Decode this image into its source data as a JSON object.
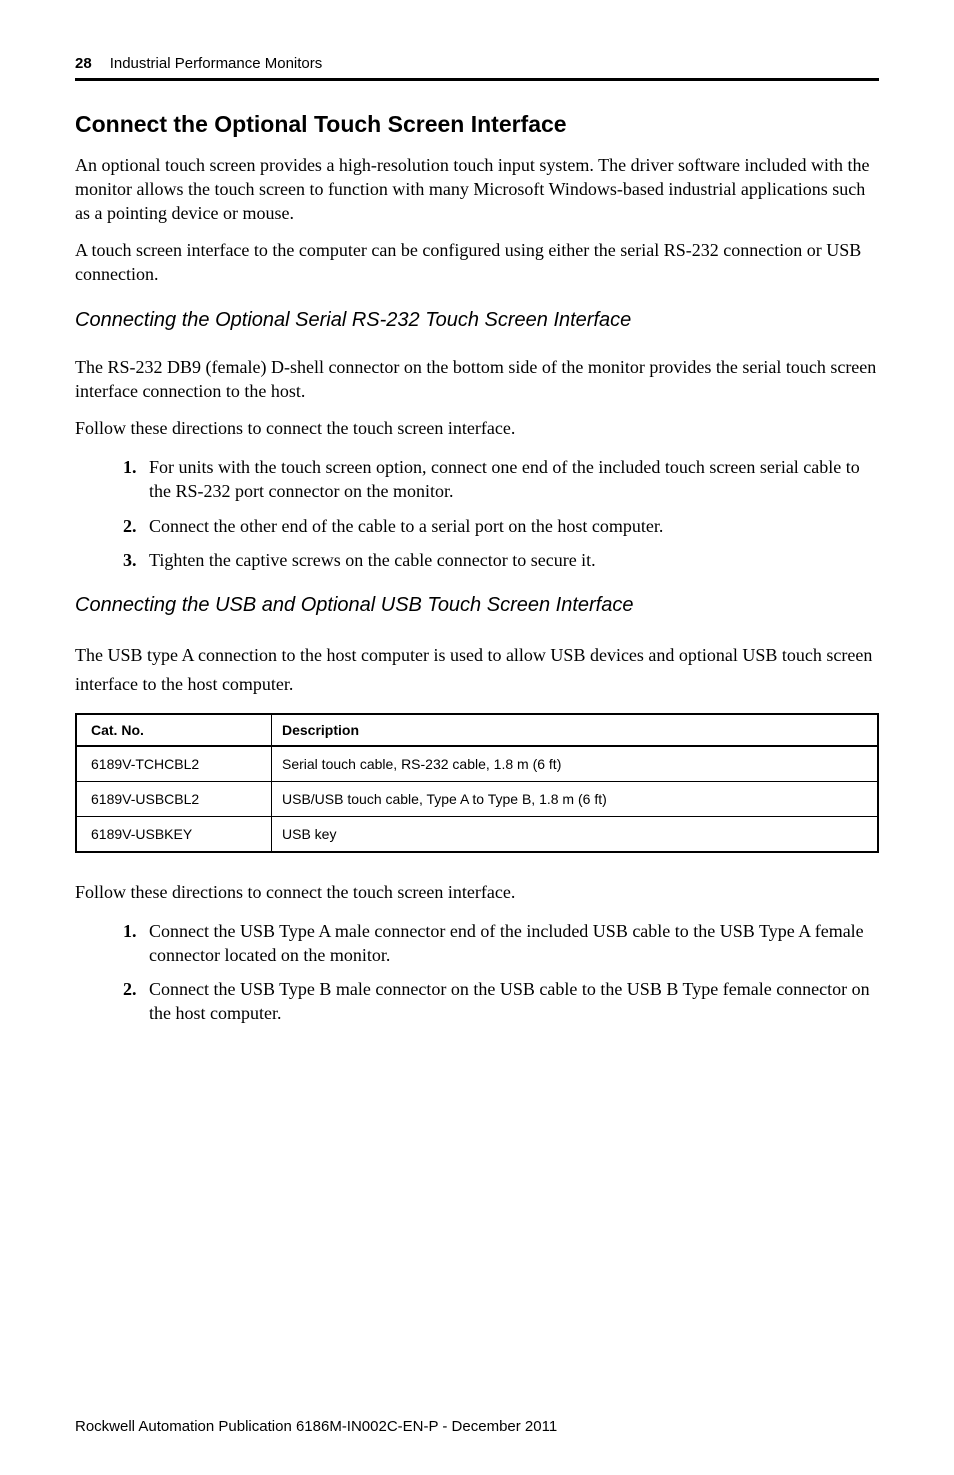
{
  "header": {
    "page_number": "28",
    "doc_title": "Industrial Performance Monitors"
  },
  "section": {
    "heading": "Connect the Optional Touch Screen Interface",
    "para1": "An optional touch screen provides a high-resolution touch input system. The driver software included with the monitor allows the touch screen to function with many Microsoft Windows-based industrial applications such as a pointing device or mouse.",
    "para2": "A touch screen interface to the computer can be configured using either the serial RS-232 connection or USB connection."
  },
  "serial": {
    "heading": "Connecting the Optional Serial RS-232 Touch Screen Interface",
    "para1": "The RS-232 DB9 (female) D-shell connector on the bottom side of the monitor provides the serial touch screen interface connection to the host.",
    "para2": "Follow these directions to connect the touch screen interface.",
    "steps": [
      "For units with the touch screen option, connect one end of the included touch screen serial cable to the RS-232 port connector on the monitor.",
      "Connect the other end of the cable to a serial port on the host computer.",
      "Tighten the captive screws on the cable connector to secure it."
    ]
  },
  "usb": {
    "heading": "Connecting the USB and Optional USB Touch Screen Interface",
    "para1": "The USB type A connection to the host computer is used to allow USB devices and optional USB touch screen interface to the host computer.",
    "table": {
      "headers": {
        "col1": "Cat. No.",
        "col2": "Description"
      },
      "rows": [
        {
          "catno": "6189V-TCHCBL2",
          "desc": "Serial touch cable, RS-232 cable, 1.8 m (6 ft)"
        },
        {
          "catno": "6189V-USBCBL2",
          "desc": "USB/USB touch cable, Type A to Type B, 1.8 m (6 ft)"
        },
        {
          "catno": "6189V-USBKEY",
          "desc": "USB key"
        }
      ]
    },
    "para2": "Follow these directions to connect the touch screen interface.",
    "steps": [
      "Connect the USB Type A male connector end of the included USB cable to the USB Type A female connector located on the monitor.",
      "Connect the USB Type B male connector on the USB cable to the USB B Type female connector on the host computer."
    ]
  },
  "footer": "Rockwell Automation Publication 6186M-IN002C-EN-P - December 2011"
}
